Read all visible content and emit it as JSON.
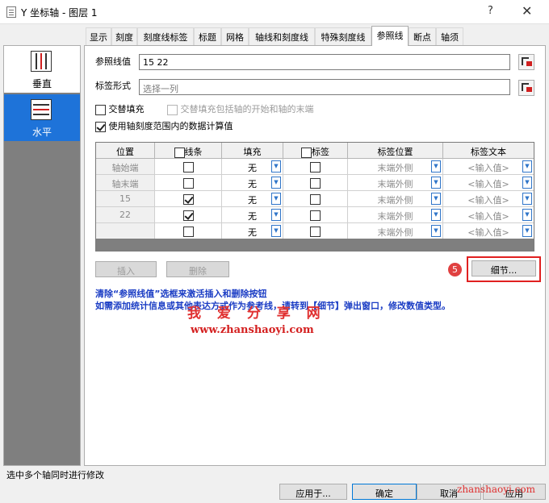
{
  "window": {
    "title": "Y 坐标轴 - 图层 1",
    "help": "?",
    "close": "✕"
  },
  "tabs": [
    "显示",
    "刻度",
    "刻度线标签",
    "标题",
    "网格",
    "轴线和刻度线",
    "特殊刻度线",
    "参照线",
    "断点",
    "轴须"
  ],
  "active_tab": "参照线",
  "axes": [
    {
      "label": "垂直",
      "selected": false
    },
    {
      "label": "水平",
      "selected": true
    }
  ],
  "form": {
    "ref_value_label": "参照线值",
    "ref_value": "15 22",
    "label_form_label": "标签形式",
    "label_form_placeholder": "选择一列",
    "alt_fill_label": "交替填充",
    "alt_fill_ends_label": "交替填充包括轴的开始和轴的末端",
    "use_axis_range_label": "使用轴刻度范围内的数据计算值"
  },
  "grid": {
    "headers": {
      "position": "位置",
      "line": "线条",
      "fill": "填充",
      "label": "标签",
      "label_pos": "标签位置",
      "label_text": "标签文本"
    },
    "rows": [
      {
        "position": "轴始端",
        "line": false,
        "fill": "无",
        "label": false,
        "label_pos": "末端外侧",
        "label_text": "<输入值>"
      },
      {
        "position": "轴末端",
        "line": false,
        "fill": "无",
        "label": false,
        "label_pos": "末端外侧",
        "label_text": "<输入值>"
      },
      {
        "position": "15",
        "line": true,
        "fill": "无",
        "label": false,
        "label_pos": "末端外侧",
        "label_text": "<输入值>"
      },
      {
        "position": "22",
        "line": true,
        "fill": "无",
        "label": false,
        "label_pos": "末端外侧",
        "label_text": "<输入值>"
      },
      {
        "position": "",
        "line": false,
        "fill": "无",
        "label": false,
        "label_pos": "末端外侧",
        "label_text": "<输入值>"
      }
    ]
  },
  "buttons": {
    "insert": "插入",
    "delete": "删除",
    "details": "细节...",
    "apply_to": "应用于...",
    "ok": "确定",
    "cancel": "取消",
    "apply": "应用"
  },
  "step_badge": "5",
  "info": {
    "line1": "清除“参照线值”选框来激活插入和删除按钮",
    "line2": "如需添加统计信息或其他表达方式作为参考线，请转到【细节】弹出窗口，修改数值类型。"
  },
  "watermark": {
    "cn": "我 爱 分 享 网",
    "url": "www.zhanshaoyi.com",
    "corner": "zhanshaoyi.com"
  },
  "status_text": "选中多个轴同时进行修改",
  "colors": {
    "selection_blue": "#1e73d9",
    "info_blue": "#1a3cc4",
    "highlight_red": "#e02020"
  }
}
